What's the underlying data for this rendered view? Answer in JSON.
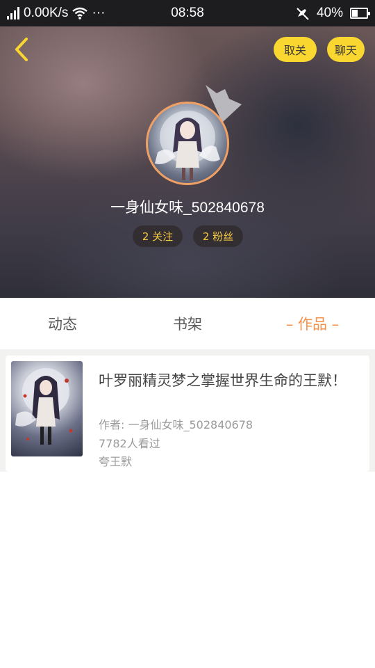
{
  "status_bar": {
    "network_speed": "0.00K/s",
    "more": "···",
    "time": "08:58",
    "battery": "40%"
  },
  "profile": {
    "unfollow_label": "取关",
    "chat_label": "聊天",
    "username": "一身仙女味_502840678",
    "following": "2 关注",
    "fans": "2 粉丝"
  },
  "tabs": [
    {
      "label": "动态"
    },
    {
      "label": "书架"
    },
    {
      "label": "– 作品 –"
    }
  ],
  "works": [
    {
      "title": "叶罗丽精灵梦之掌握世界生命的王默！",
      "author": "作者: 一身仙女味_502840678",
      "views": "7782人看过",
      "tag": "夸王默"
    }
  ],
  "colors": {
    "accent": "#f4904a",
    "button_yellow": "#f9d630",
    "chip_text": "#f5c843"
  },
  "icons": {
    "back": "chevron-left-icon",
    "crown": "crown-icon",
    "wifi": "wifi-icon",
    "signal": "signal-icon",
    "mute": "mute-icon",
    "battery": "battery-icon"
  }
}
